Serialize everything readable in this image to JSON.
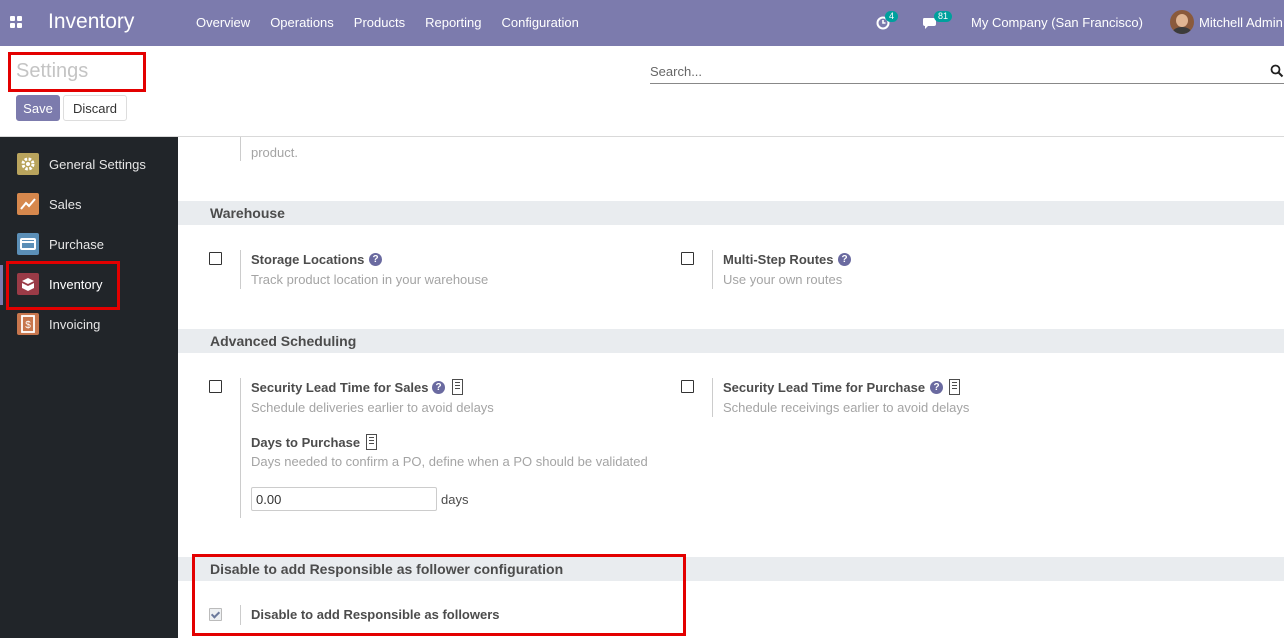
{
  "navbar": {
    "app_name": "Inventory",
    "menu": [
      "Overview",
      "Operations",
      "Products",
      "Reporting",
      "Configuration"
    ],
    "activity_count": "4",
    "message_count": "81",
    "company": "My Company (San Francisco)",
    "user": "Mitchell Admin"
  },
  "control_panel": {
    "title": "Settings",
    "save_label": "Save",
    "discard_label": "Discard",
    "search_placeholder": "Search..."
  },
  "sidebar": {
    "items": [
      {
        "label": "General Settings",
        "icon": "gear-icon",
        "color": "#b9a45d"
      },
      {
        "label": "Sales",
        "icon": "sales-chart-icon",
        "color": "#d6884d"
      },
      {
        "label": "Purchase",
        "icon": "purchase-card-icon",
        "color": "#5b8fb7"
      },
      {
        "label": "Inventory",
        "icon": "inventory-box-icon",
        "color": "#9a3b47"
      },
      {
        "label": "Invoicing",
        "icon": "invoice-dollar-icon",
        "color": "#c7764d"
      }
    ]
  },
  "main": {
    "cut_text": "product.",
    "warehouse": {
      "heading": "Warehouse",
      "storage_title": "Storage Locations",
      "storage_desc": "Track product location in your warehouse",
      "routes_title": "Multi-Step Routes",
      "routes_desc": "Use your own routes"
    },
    "scheduling": {
      "heading": "Advanced Scheduling",
      "sales_title": "Security Lead Time for Sales",
      "sales_desc": "Schedule deliveries earlier to avoid delays",
      "purchase_title": "Security Lead Time for Purchase",
      "purchase_desc": "Schedule receivings earlier to avoid delays",
      "days_title": "Days to Purchase",
      "days_desc": "Days needed to confirm a PO, define when a PO should be validated",
      "days_value": "0.00",
      "days_unit": "days"
    },
    "follower": {
      "heading": "Disable to add Responsible as follower configuration",
      "option_title": "Disable to add Responsible as followers"
    }
  },
  "colors": {
    "navbar": "#7c7bad",
    "sidebar": "#212529",
    "highlight": "#e30000",
    "help": "#6a6aa0"
  }
}
